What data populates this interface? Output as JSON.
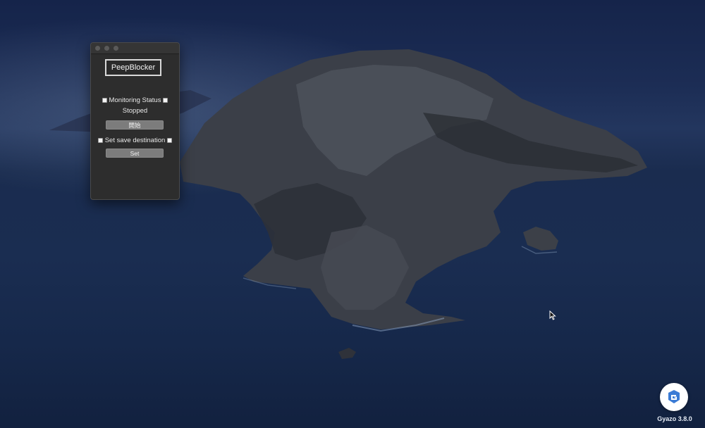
{
  "app": {
    "title": "PeepBlocker",
    "monitoring_label": "Monitoring Status",
    "status_value": "Stopped",
    "start_button": "開始",
    "destination_label": "Set save destination",
    "set_button": "Set"
  },
  "overlay": {
    "gyazo_version": "Gyazo 3.8.0"
  },
  "colors": {
    "window_bg": "#2d2d2d",
    "button_bg": "#7c7c7c",
    "gyazo_blue": "#3a7bd5"
  },
  "icons": {
    "gyazo": "gyazo-logo-icon",
    "cursor": "mouse-pointer-icon"
  }
}
